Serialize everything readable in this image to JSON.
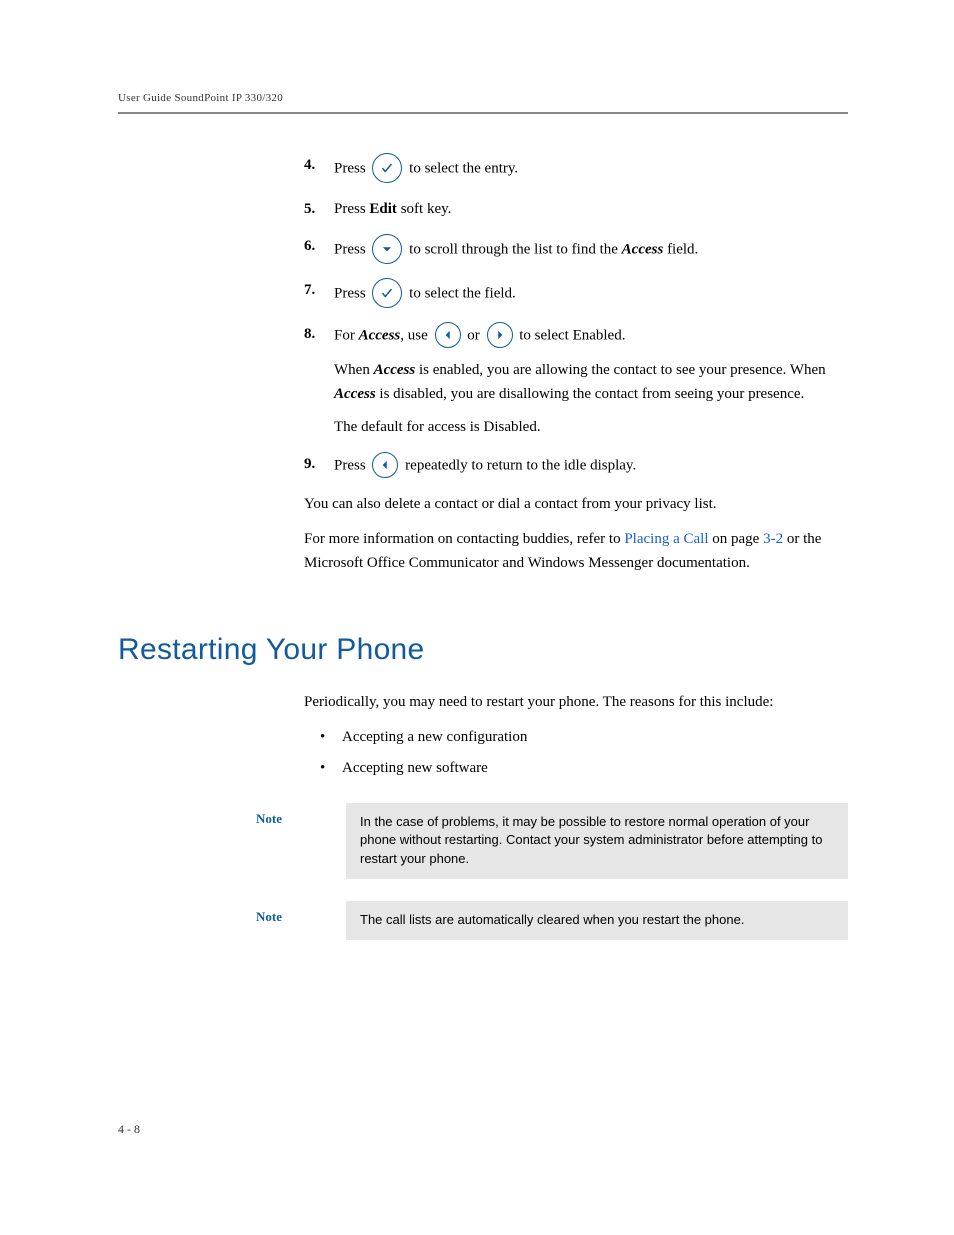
{
  "header": "User Guide SoundPoint IP 330/320",
  "steps": [
    {
      "num": "4.",
      "parts": [
        {
          "t": "Press "
        },
        {
          "icon": "check"
        },
        {
          "t": " to select the entry."
        }
      ]
    },
    {
      "num": "5.",
      "parts": [
        {
          "t": "Press "
        },
        {
          "bold": "Edit"
        },
        {
          "t": " soft key."
        }
      ]
    },
    {
      "num": "6.",
      "parts": [
        {
          "t": "Press "
        },
        {
          "icon": "down"
        },
        {
          "t": " to scroll through the list to find the "
        },
        {
          "bi": "Access"
        },
        {
          "t": " field."
        }
      ]
    },
    {
      "num": "7.",
      "parts": [
        {
          "t": "Press "
        },
        {
          "icon": "check"
        },
        {
          "t": " to select the field."
        }
      ]
    },
    {
      "num": "8.",
      "parts": [
        {
          "t": "For "
        },
        {
          "bi": "Access"
        },
        {
          "t": ", use "
        },
        {
          "icon": "left"
        },
        {
          "t": " or "
        },
        {
          "icon": "right"
        },
        {
          "t": " to select Enabled."
        }
      ],
      "extra": [
        "When Access is enabled, you are allowing the contact to see your presence. When Access is disabled, you are disallowing the contact from seeing your presence.",
        "The default for access is Disabled."
      ],
      "extraBI": [
        "Access",
        "Access"
      ]
    },
    {
      "num": "9.",
      "parts": [
        {
          "t": "Press "
        },
        {
          "icon": "left"
        },
        {
          "t": " repeatedly to return to the idle display."
        }
      ]
    }
  ],
  "afterSteps": {
    "p1": "You can also delete a contact or dial a contact from your privacy list.",
    "p2a": "For more information on contacting buddies, refer to ",
    "p2link": "Placing a Call",
    "p2b": " on page ",
    "p2page": "3-2",
    "p2c": " or the Microsoft Office Communicator and Windows Messenger documentation."
  },
  "section": {
    "heading": "Restarting Your Phone",
    "intro": "Periodically, you may need to restart your phone. The reasons for this include:",
    "bullets": [
      "Accepting a new configuration",
      "Accepting new software"
    ]
  },
  "notes": [
    {
      "label": "Note",
      "body": "In the case of problems, it may be possible to restore normal operation of your phone without restarting. Contact your system administrator before attempting to restart your phone."
    },
    {
      "label": "Note",
      "body": "The call lists are automatically cleared when you restart the phone."
    }
  ],
  "pageNum": "4 - 8"
}
